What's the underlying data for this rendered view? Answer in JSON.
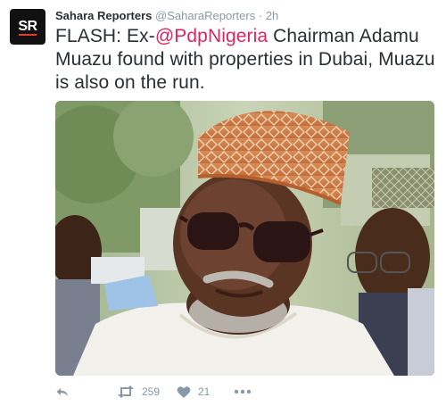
{
  "tweet": {
    "avatar_text": "SR",
    "author_name": "Sahara Reporters",
    "author_handle": "@SaharaReporters",
    "separator": "·",
    "timestamp": "2h",
    "text_prefix": "FLASH: Ex-",
    "mention": "@PdpNigeria",
    "text_suffix": " Chairman Adamu Muazu found with properties in Dubai, Muazu is also on the run.",
    "photo_alt": "",
    "mention_color": "#e0245e"
  },
  "actions": {
    "reply_icon": "reply-icon",
    "retweet_icon": "retweet-icon",
    "retweet_count": "259",
    "like_icon": "heart-icon",
    "like_count": "21",
    "more_icon": "more-icon"
  }
}
